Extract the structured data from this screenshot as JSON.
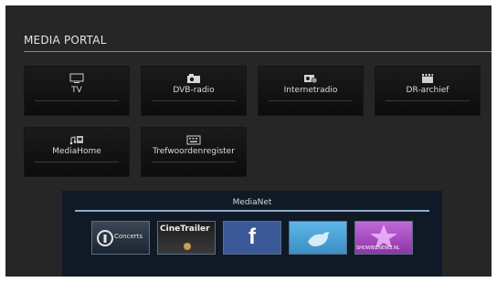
{
  "portal": {
    "title": "MEDIA PORTAL",
    "tiles": [
      {
        "label": "TV",
        "icon": "tv-icon"
      },
      {
        "label": "DVB-radio",
        "icon": "radio-icon"
      },
      {
        "label": "Internetradio",
        "icon": "internet-radio-icon"
      },
      {
        "label": "DR-archief",
        "icon": "film-clapper-icon"
      },
      {
        "label": "MediaHome",
        "icon": "music-photo-icon"
      },
      {
        "label": "Trefwoordenregister",
        "icon": "keyboard-icon"
      }
    ]
  },
  "medianet": {
    "title": "MediaNet",
    "apps": [
      {
        "name": "iConcerts",
        "text": "Concerts"
      },
      {
        "name": "CineTrailer",
        "text": "CineTrailer"
      },
      {
        "name": "Facebook",
        "text": "f"
      },
      {
        "name": "Twitter",
        "text": ""
      },
      {
        "name": "ShowbizNewz",
        "text": "SHOWBIZNEWZ.NL"
      }
    ]
  },
  "colors": {
    "accent": "#8fa8c8",
    "background": "#262626",
    "facebook": "#3b5998",
    "twitter": "#4aa3d9",
    "showbiz": "#b04cc8"
  }
}
